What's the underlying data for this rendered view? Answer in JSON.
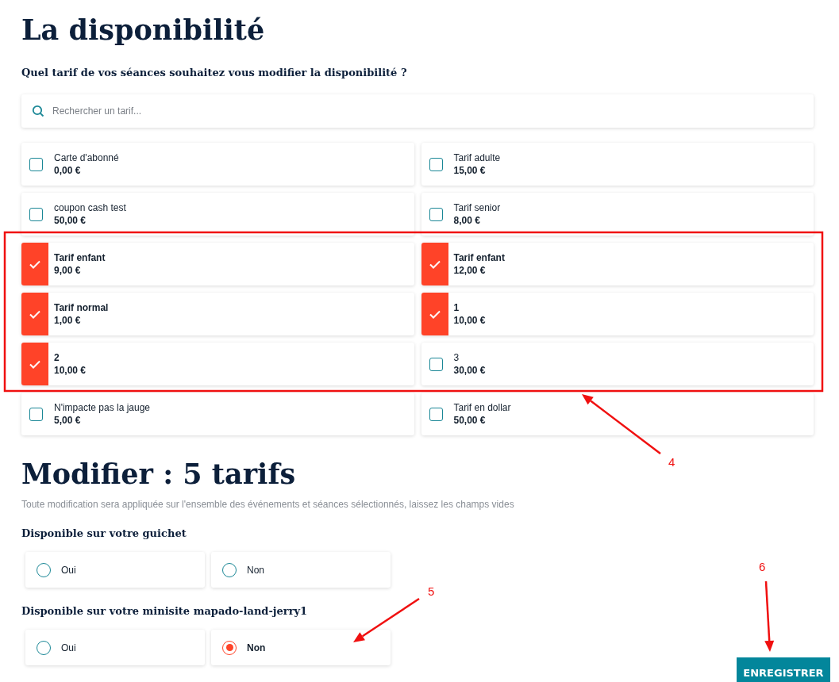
{
  "title": "La disponibilité",
  "question": "Quel tarif de vos séances souhaitez vous modifier la disponibilité ?",
  "search": {
    "placeholder": "Rechercher un tarif..."
  },
  "tariffs": [
    {
      "name": "Carte d'abonné",
      "price": "0,00 €",
      "checked": false
    },
    {
      "name": "Tarif adulte",
      "price": "15,00 €",
      "checked": false
    },
    {
      "name": "coupon cash test",
      "price": "50,00 €",
      "checked": false
    },
    {
      "name": "Tarif senior",
      "price": "8,00 €",
      "checked": false
    },
    {
      "name": "Tarif enfant",
      "price": "9,00 €",
      "checked": true
    },
    {
      "name": "Tarif enfant",
      "price": "12,00 €",
      "checked": true
    },
    {
      "name": "Tarif normal",
      "price": "1,00 €",
      "checked": true
    },
    {
      "name": "1",
      "price": "10,00 €",
      "checked": true
    },
    {
      "name": "2",
      "price": "10,00 €",
      "checked": true
    },
    {
      "name": "3",
      "price": "30,00 €",
      "checked": false
    },
    {
      "name": "N'impacte pas la jauge",
      "price": "5,00 €",
      "checked": false
    },
    {
      "name": "Tarif en dollar",
      "price": "50,00 €",
      "checked": false
    }
  ],
  "edit": {
    "title": "Modifier : 5 tarifs",
    "note": "Toute modification sera appliquée sur l'ensemble des événements et séances sélectionnés, laissez les champs vides"
  },
  "groups": [
    {
      "label": "Disponible sur votre guichet",
      "options": [
        {
          "label": "Oui",
          "selected": false
        },
        {
          "label": "Non",
          "selected": false
        }
      ]
    },
    {
      "label": "Disponible sur votre minisite mapado-land-jerry1",
      "options": [
        {
          "label": "Oui",
          "selected": false
        },
        {
          "label": "Non",
          "selected": true
        }
      ]
    }
  ],
  "save_button": "ENREGISTRER",
  "annotations": [
    {
      "kind": "box"
    },
    {
      "kind": "arrow",
      "label": "4"
    },
    {
      "kind": "arrow",
      "label": "5"
    },
    {
      "kind": "arrow",
      "label": "6"
    }
  ]
}
